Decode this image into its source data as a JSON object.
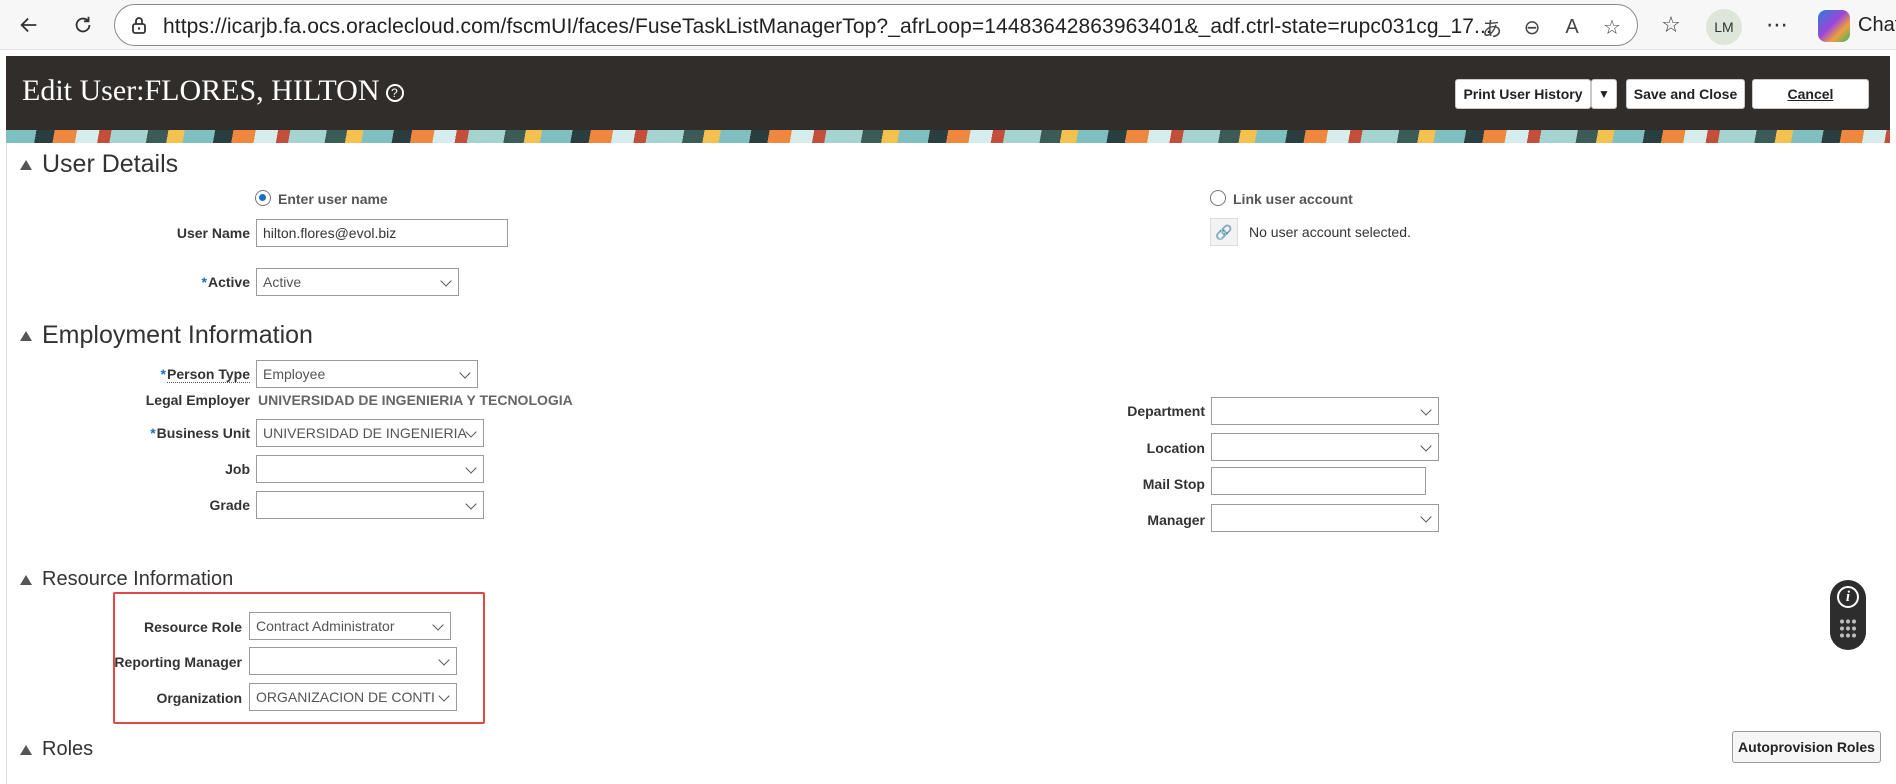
{
  "browser": {
    "url": "https://icarjb.fa.ocs.oraclecloud.com/fscmUI/faces/FuseTaskListManagerTop?_afrLoop=14483642863963401&_adf.ctrl-state=rupc031cg_17...",
    "profile_initials": "LM",
    "chat_label": "Chat"
  },
  "header": {
    "title": "Edit User:FLORES, HILTON",
    "print_history_label": "Print User History",
    "save_close_label": "Save and Close",
    "cancel_label": "Cancel"
  },
  "user_details": {
    "heading": "User Details",
    "enter_user_name_label": "Enter user name",
    "link_account_label": "Link user account",
    "user_name_label": "User Name",
    "user_name_value": "hilton.flores@evol.biz",
    "no_account_text": "No user account selected.",
    "active_label": "Active",
    "active_value": "Active"
  },
  "employment": {
    "heading": "Employment Information",
    "person_type_label": "Person Type",
    "person_type_value": "Employee",
    "legal_employer_label": "Legal Employer",
    "legal_employer_value": "UNIVERSIDAD DE INGENIERIA Y TECNOLOGIA",
    "business_unit_label": "Business Unit",
    "business_unit_value": "UNIVERSIDAD DE INGENIERIA",
    "job_label": "Job",
    "job_value": "",
    "grade_label": "Grade",
    "grade_value": "",
    "department_label": "Department",
    "department_value": "",
    "location_label": "Location",
    "location_value": "",
    "mail_stop_label": "Mail Stop",
    "mail_stop_value": "",
    "manager_label": "Manager",
    "manager_value": ""
  },
  "resource": {
    "heading": "Resource Information",
    "role_label": "Resource Role",
    "role_value": "Contract Administrator",
    "reporting_manager_label": "Reporting Manager",
    "reporting_manager_value": "",
    "organization_label": "Organization",
    "organization_value": "ORGANIZACION DE CONTI"
  },
  "roles": {
    "heading": "Roles",
    "autoprovision_label": "Autoprovision Roles"
  },
  "colors": {
    "header_bg": "#312d2a",
    "required_star": "#1a6fc0",
    "highlight_border": "#e04848"
  }
}
